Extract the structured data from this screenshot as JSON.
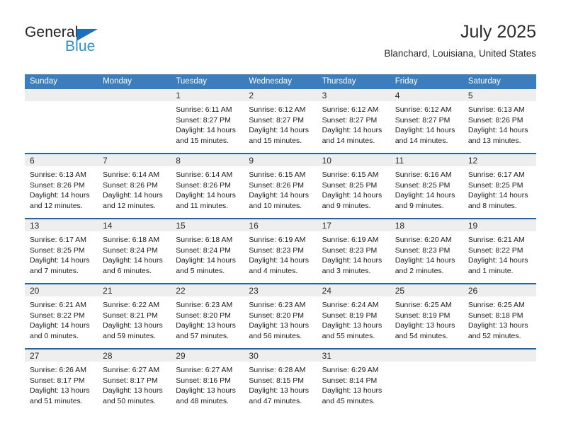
{
  "brand": {
    "name_dark": "General",
    "name_light": "Blue",
    "triangle_color": "#1c6fba",
    "light_color": "#2b8fd6"
  },
  "header": {
    "title": "July 2025",
    "subtitle": "Blanchard, Louisiana, United States"
  },
  "theme": {
    "header_bg": "#3a7ebf",
    "row_separator": "#1f66ad",
    "day_strip_bg": "#eeeeee",
    "text": "#1a1a1a"
  },
  "weekdays": [
    "Sunday",
    "Monday",
    "Tuesday",
    "Wednesday",
    "Thursday",
    "Friday",
    "Saturday"
  ],
  "weeks": [
    [
      {
        "day": "",
        "sunrise": "",
        "sunset": "",
        "daylight1": "",
        "daylight2": ""
      },
      {
        "day": "",
        "sunrise": "",
        "sunset": "",
        "daylight1": "",
        "daylight2": ""
      },
      {
        "day": "1",
        "sunrise": "Sunrise: 6:11 AM",
        "sunset": "Sunset: 8:27 PM",
        "daylight1": "Daylight: 14 hours",
        "daylight2": "and 15 minutes."
      },
      {
        "day": "2",
        "sunrise": "Sunrise: 6:12 AM",
        "sunset": "Sunset: 8:27 PM",
        "daylight1": "Daylight: 14 hours",
        "daylight2": "and 15 minutes."
      },
      {
        "day": "3",
        "sunrise": "Sunrise: 6:12 AM",
        "sunset": "Sunset: 8:27 PM",
        "daylight1": "Daylight: 14 hours",
        "daylight2": "and 14 minutes."
      },
      {
        "day": "4",
        "sunrise": "Sunrise: 6:12 AM",
        "sunset": "Sunset: 8:27 PM",
        "daylight1": "Daylight: 14 hours",
        "daylight2": "and 14 minutes."
      },
      {
        "day": "5",
        "sunrise": "Sunrise: 6:13 AM",
        "sunset": "Sunset: 8:26 PM",
        "daylight1": "Daylight: 14 hours",
        "daylight2": "and 13 minutes."
      }
    ],
    [
      {
        "day": "6",
        "sunrise": "Sunrise: 6:13 AM",
        "sunset": "Sunset: 8:26 PM",
        "daylight1": "Daylight: 14 hours",
        "daylight2": "and 12 minutes."
      },
      {
        "day": "7",
        "sunrise": "Sunrise: 6:14 AM",
        "sunset": "Sunset: 8:26 PM",
        "daylight1": "Daylight: 14 hours",
        "daylight2": "and 12 minutes."
      },
      {
        "day": "8",
        "sunrise": "Sunrise: 6:14 AM",
        "sunset": "Sunset: 8:26 PM",
        "daylight1": "Daylight: 14 hours",
        "daylight2": "and 11 minutes."
      },
      {
        "day": "9",
        "sunrise": "Sunrise: 6:15 AM",
        "sunset": "Sunset: 8:26 PM",
        "daylight1": "Daylight: 14 hours",
        "daylight2": "and 10 minutes."
      },
      {
        "day": "10",
        "sunrise": "Sunrise: 6:15 AM",
        "sunset": "Sunset: 8:25 PM",
        "daylight1": "Daylight: 14 hours",
        "daylight2": "and 9 minutes."
      },
      {
        "day": "11",
        "sunrise": "Sunrise: 6:16 AM",
        "sunset": "Sunset: 8:25 PM",
        "daylight1": "Daylight: 14 hours",
        "daylight2": "and 9 minutes."
      },
      {
        "day": "12",
        "sunrise": "Sunrise: 6:17 AM",
        "sunset": "Sunset: 8:25 PM",
        "daylight1": "Daylight: 14 hours",
        "daylight2": "and 8 minutes."
      }
    ],
    [
      {
        "day": "13",
        "sunrise": "Sunrise: 6:17 AM",
        "sunset": "Sunset: 8:25 PM",
        "daylight1": "Daylight: 14 hours",
        "daylight2": "and 7 minutes."
      },
      {
        "day": "14",
        "sunrise": "Sunrise: 6:18 AM",
        "sunset": "Sunset: 8:24 PM",
        "daylight1": "Daylight: 14 hours",
        "daylight2": "and 6 minutes."
      },
      {
        "day": "15",
        "sunrise": "Sunrise: 6:18 AM",
        "sunset": "Sunset: 8:24 PM",
        "daylight1": "Daylight: 14 hours",
        "daylight2": "and 5 minutes."
      },
      {
        "day": "16",
        "sunrise": "Sunrise: 6:19 AM",
        "sunset": "Sunset: 8:23 PM",
        "daylight1": "Daylight: 14 hours",
        "daylight2": "and 4 minutes."
      },
      {
        "day": "17",
        "sunrise": "Sunrise: 6:19 AM",
        "sunset": "Sunset: 8:23 PM",
        "daylight1": "Daylight: 14 hours",
        "daylight2": "and 3 minutes."
      },
      {
        "day": "18",
        "sunrise": "Sunrise: 6:20 AM",
        "sunset": "Sunset: 8:23 PM",
        "daylight1": "Daylight: 14 hours",
        "daylight2": "and 2 minutes."
      },
      {
        "day": "19",
        "sunrise": "Sunrise: 6:21 AM",
        "sunset": "Sunset: 8:22 PM",
        "daylight1": "Daylight: 14 hours",
        "daylight2": "and 1 minute."
      }
    ],
    [
      {
        "day": "20",
        "sunrise": "Sunrise: 6:21 AM",
        "sunset": "Sunset: 8:22 PM",
        "daylight1": "Daylight: 14 hours",
        "daylight2": "and 0 minutes."
      },
      {
        "day": "21",
        "sunrise": "Sunrise: 6:22 AM",
        "sunset": "Sunset: 8:21 PM",
        "daylight1": "Daylight: 13 hours",
        "daylight2": "and 59 minutes."
      },
      {
        "day": "22",
        "sunrise": "Sunrise: 6:23 AM",
        "sunset": "Sunset: 8:20 PM",
        "daylight1": "Daylight: 13 hours",
        "daylight2": "and 57 minutes."
      },
      {
        "day": "23",
        "sunrise": "Sunrise: 6:23 AM",
        "sunset": "Sunset: 8:20 PM",
        "daylight1": "Daylight: 13 hours",
        "daylight2": "and 56 minutes."
      },
      {
        "day": "24",
        "sunrise": "Sunrise: 6:24 AM",
        "sunset": "Sunset: 8:19 PM",
        "daylight1": "Daylight: 13 hours",
        "daylight2": "and 55 minutes."
      },
      {
        "day": "25",
        "sunrise": "Sunrise: 6:25 AM",
        "sunset": "Sunset: 8:19 PM",
        "daylight1": "Daylight: 13 hours",
        "daylight2": "and 54 minutes."
      },
      {
        "day": "26",
        "sunrise": "Sunrise: 6:25 AM",
        "sunset": "Sunset: 8:18 PM",
        "daylight1": "Daylight: 13 hours",
        "daylight2": "and 52 minutes."
      }
    ],
    [
      {
        "day": "27",
        "sunrise": "Sunrise: 6:26 AM",
        "sunset": "Sunset: 8:17 PM",
        "daylight1": "Daylight: 13 hours",
        "daylight2": "and 51 minutes."
      },
      {
        "day": "28",
        "sunrise": "Sunrise: 6:27 AM",
        "sunset": "Sunset: 8:17 PM",
        "daylight1": "Daylight: 13 hours",
        "daylight2": "and 50 minutes."
      },
      {
        "day": "29",
        "sunrise": "Sunrise: 6:27 AM",
        "sunset": "Sunset: 8:16 PM",
        "daylight1": "Daylight: 13 hours",
        "daylight2": "and 48 minutes."
      },
      {
        "day": "30",
        "sunrise": "Sunrise: 6:28 AM",
        "sunset": "Sunset: 8:15 PM",
        "daylight1": "Daylight: 13 hours",
        "daylight2": "and 47 minutes."
      },
      {
        "day": "31",
        "sunrise": "Sunrise: 6:29 AM",
        "sunset": "Sunset: 8:14 PM",
        "daylight1": "Daylight: 13 hours",
        "daylight2": "and 45 minutes."
      },
      {
        "day": "",
        "sunrise": "",
        "sunset": "",
        "daylight1": "",
        "daylight2": ""
      },
      {
        "day": "",
        "sunrise": "",
        "sunset": "",
        "daylight1": "",
        "daylight2": ""
      }
    ]
  ]
}
